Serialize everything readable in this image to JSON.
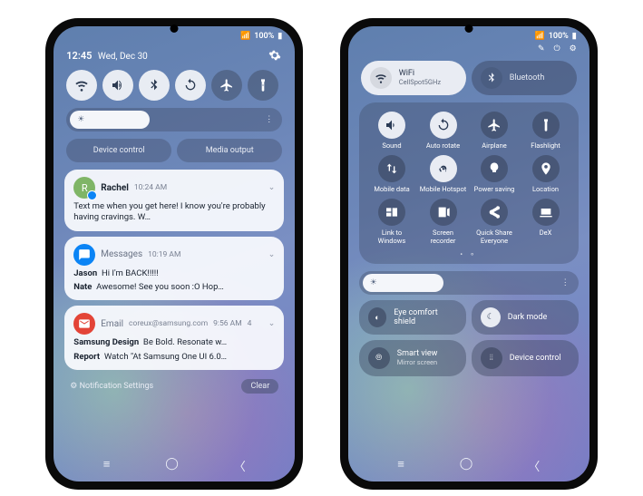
{
  "status_bar": {
    "signal": "▲",
    "wifi": "⦿",
    "battery": "100%"
  },
  "notif_panel": {
    "time": "12:45",
    "date": "Wed, Dec 30",
    "toggles": [
      "wifi",
      "sound",
      "bluetooth",
      "rotate",
      "airplane",
      "flashlight"
    ],
    "brightness_pct": 38,
    "pills": {
      "device_control": "Device control",
      "media_output": "Media output"
    },
    "notifications": [
      {
        "app": "rachel",
        "avatar_letter": "R",
        "title": "Rachel",
        "time": "10:24 AM",
        "body": "Text me when you get here! I know you're probably having cravings. W…"
      },
      {
        "app": "messages",
        "header": "Messages",
        "time": "10:19 AM",
        "lines": [
          {
            "sender": "Jason",
            "text": "Hi I'm BACK!!!!!"
          },
          {
            "sender": "Nate",
            "text": "Awesome! See you soon :O Hop…"
          }
        ]
      },
      {
        "app": "email",
        "header": "Email",
        "account": "coreux@samsung.com",
        "time": "9:56 AM",
        "count": "4",
        "lines": [
          {
            "sender": "Samsung Design",
            "text": "Be Bold. Resonate w…"
          },
          {
            "sender": "Report",
            "text": "Watch \"At Samsung One UI 6.0…"
          }
        ]
      }
    ],
    "footer": {
      "settings": "Notification Settings",
      "clear": "Clear"
    }
  },
  "qs_panel": {
    "big_wifi": {
      "label": "WiFi",
      "sub": "CellSpot5GHz",
      "on": true
    },
    "big_bt": {
      "label": "Bluetooth",
      "on": false
    },
    "grid": [
      {
        "id": "sound",
        "label": "Sound",
        "on": true
      },
      {
        "id": "autorotate",
        "label": "Auto rotate",
        "on": true
      },
      {
        "id": "airplane",
        "label": "Airplane",
        "on": false
      },
      {
        "id": "flashlight",
        "label": "Flashlight",
        "on": false
      },
      {
        "id": "mobiledata",
        "label": "Mobile data",
        "on": false
      },
      {
        "id": "hotspot",
        "label": "Mobile Hotspot",
        "on": true
      },
      {
        "id": "powersave",
        "label": "Power saving",
        "on": false
      },
      {
        "id": "location",
        "label": "Location",
        "on": false
      },
      {
        "id": "linkwindows",
        "label": "Link to Windows",
        "on": false
      },
      {
        "id": "recorder",
        "label": "Screen recorder",
        "on": false
      },
      {
        "id": "quickshare",
        "label": "Quick Share Everyone",
        "on": false
      },
      {
        "id": "dex",
        "label": "DeX",
        "on": false
      }
    ],
    "brightness_pct": 38,
    "eye_comfort": {
      "label": "Eye comfort shield",
      "on": false
    },
    "dark_mode": {
      "label": "Dark mode",
      "on": true
    },
    "smart_view": {
      "label": "Smart view",
      "sub": "Mirror screen"
    },
    "device_ctrl": {
      "label": "Device control"
    }
  }
}
